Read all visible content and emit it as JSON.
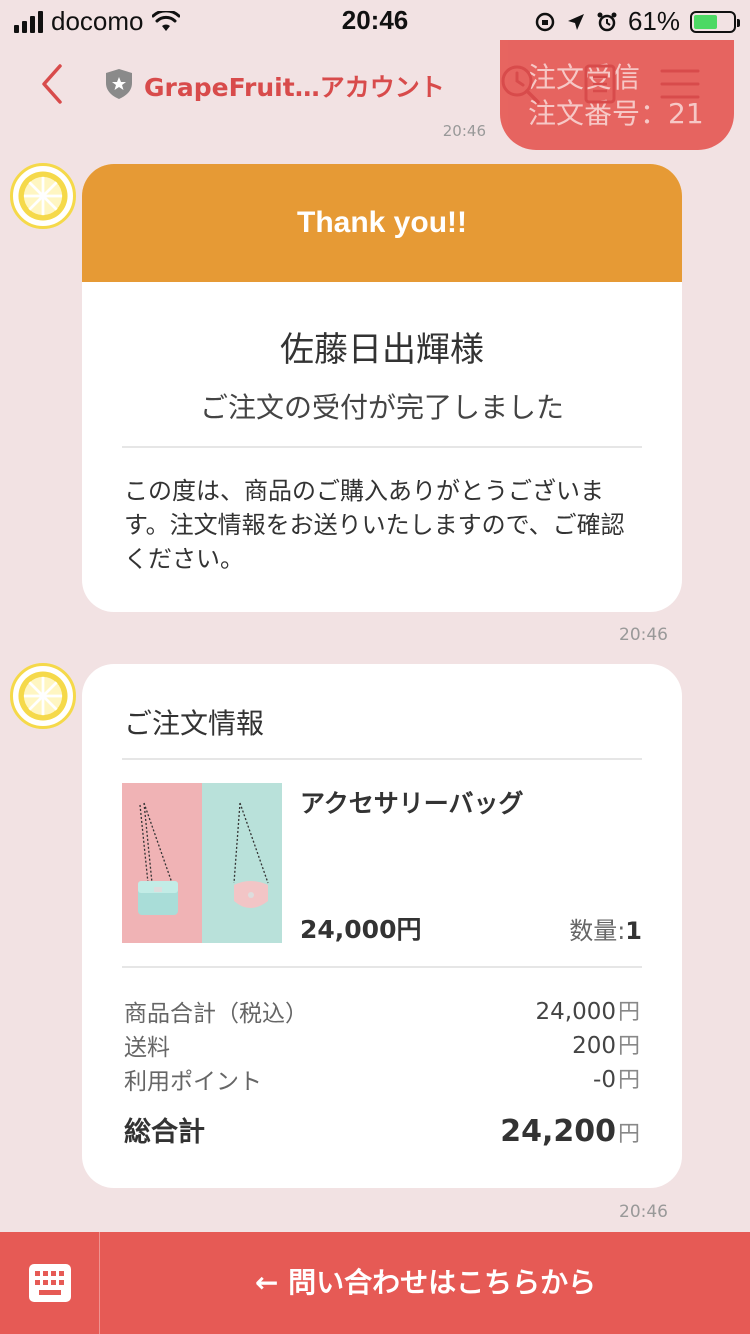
{
  "status_bar": {
    "carrier": "docomo",
    "time": "20:46",
    "battery": "61%"
  },
  "header": {
    "title": "GrapeFruit…アカウント",
    "icons": [
      "back-icon",
      "shield-icon",
      "search-clock-icon",
      "notes-icon",
      "menu-icon"
    ]
  },
  "previous_message": {
    "lines": [
      "注文受信",
      "注文番号：21"
    ],
    "time": "20:46"
  },
  "thank_card": {
    "heading": "Thank you!!",
    "customer_name": "佐藤日出輝様",
    "status": "ご注文の受付が完了しました",
    "message": "この度は、商品のご購入ありがとうございます。注文情報をお送りいたしますので、ご確認ください。",
    "time": "20:46"
  },
  "order_card": {
    "title": "ご注文情報",
    "product": {
      "name": "アクセサリーバッグ",
      "price": "24,000円",
      "qty_label": "数量:",
      "qty": "1"
    },
    "summary": [
      {
        "label": "商品合計（税込）",
        "value": "24,000",
        "unit": "円"
      },
      {
        "label": "送料",
        "value": "200",
        "unit": "円"
      },
      {
        "label": "利用ポイント",
        "value": "-0",
        "unit": "円"
      }
    ],
    "total": {
      "label": "総合計",
      "value": "24,200",
      "unit": "円"
    },
    "time": "20:46"
  },
  "bottom_bar": {
    "contact_label": "← 問い合わせはこちらから"
  },
  "colors": {
    "background": "#f2e2e3",
    "accent_red": "#e65a55",
    "title_red": "#d84b4b",
    "header_orange": "#e69a35"
  }
}
